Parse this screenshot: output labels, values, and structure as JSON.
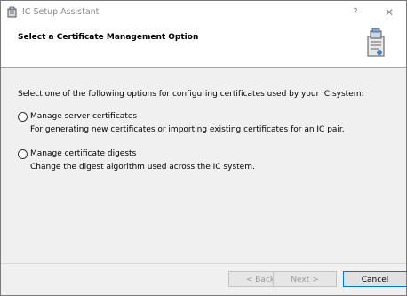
{
  "window": {
    "title": "IC Setup Assistant",
    "help_label": "?",
    "close_label": "✕"
  },
  "header": {
    "title": "Select a Certificate Management Option"
  },
  "main": {
    "prompt": "Select one of the following options for configuring certificates used by your IC system:",
    "options": [
      {
        "label": "Manage server certificates",
        "description": "For generating new certificates or importing existing certificates for an IC pair."
      },
      {
        "label": "Manage certificate digests",
        "description": "Change the digest algorithm used across the IC system."
      }
    ]
  },
  "footer": {
    "back_label": "< Back",
    "next_label": "Next >",
    "cancel_label": "Cancel"
  },
  "colors": {
    "accent": "#0078d7",
    "header_bg": "#ffffff",
    "body_bg": "#f0f0f0"
  }
}
